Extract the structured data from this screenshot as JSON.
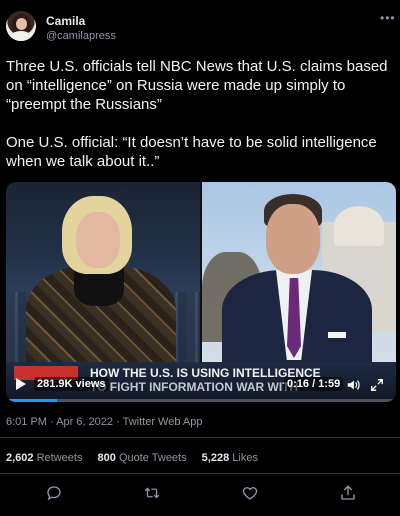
{
  "author": {
    "name": "Camila",
    "handle": "@camilapress"
  },
  "more_icon": "•••",
  "tweet": {
    "paragraph1": "Three U.S. officials tell NBC News that U.S. claims based on “intelligence” on Russia were made up simply to “preempt the Russians”",
    "paragraph2": "One U.S. official: “It doesn’t have to be solid intelligence when we talk about it..”"
  },
  "video": {
    "headline_line1": "HOW THE U.S. IS USING INTELLIGENCE",
    "headline_line2": "TO FIGHT INFORMATION WAR WITH",
    "views": "281.9K views",
    "time": "0:16 / 1:59",
    "progress_fraction": 0.13
  },
  "meta": {
    "timestamp": "6:01 PM · Apr 6, 2022 · Twitter Web App"
  },
  "stats": {
    "retweets_count": "2,602",
    "retweets_label": "Retweets",
    "quotes_count": "800",
    "quotes_label": "Quote Tweets",
    "likes_count": "5,228",
    "likes_label": "Likes"
  },
  "actions": {
    "icons": [
      "reply-icon",
      "retweet-icon",
      "like-icon",
      "share-icon"
    ]
  },
  "colors": {
    "background": "#000000",
    "text": "#e7e9ea",
    "muted": "#8b98a5",
    "accent": "#1d9bf0"
  }
}
